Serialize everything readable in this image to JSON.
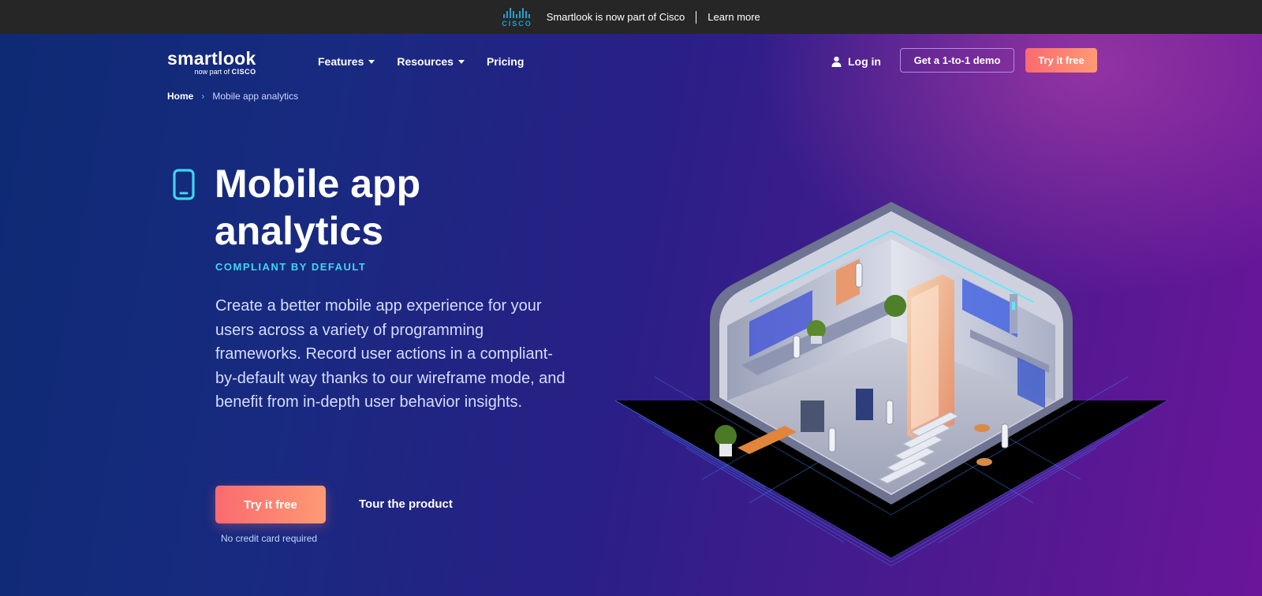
{
  "announcement": {
    "brand_wordmark": "CISCO",
    "message": "Smartlook is now part of Cisco",
    "link": "Learn more"
  },
  "header": {
    "logo": {
      "name": "smartlook",
      "tagline_prefix": "now part of",
      "tagline_brand": "CISCO"
    },
    "nav": [
      {
        "label": "Features",
        "has_dropdown": true
      },
      {
        "label": "Resources",
        "has_dropdown": true
      },
      {
        "label": "Pricing",
        "has_dropdown": false
      }
    ],
    "login_label": "Log in",
    "demo_label": "Get a 1-to-1 demo",
    "try_label": "Try it free"
  },
  "breadcrumb": {
    "home": "Home",
    "current": "Mobile app analytics"
  },
  "hero": {
    "title": "Mobile app analytics",
    "eyebrow": "COMPLIANT BY DEFAULT",
    "lead": "Create a better mobile app experience for your users across a variety of programming frameworks. Record user actions in a compliant-by-default way thanks to our wireframe mode, and benefit from in-depth user behavior insights.",
    "primary_cta": "Try it free",
    "secondary_cta": "Tour the product",
    "note": "No credit card required"
  },
  "icons": {
    "hero_icon": "mobile-phone-icon",
    "login_icon": "user-icon",
    "dropdown_icon": "caret-down-icon",
    "breadcrumb_separator": "chevron-right-icon"
  },
  "colors": {
    "accent_gradient_start": "#fb6a6f",
    "accent_gradient_end": "#fd9a74",
    "eyebrow": "#3fd5ee",
    "topbar": "#262626",
    "cisco_blue": "#1ba0d7"
  }
}
